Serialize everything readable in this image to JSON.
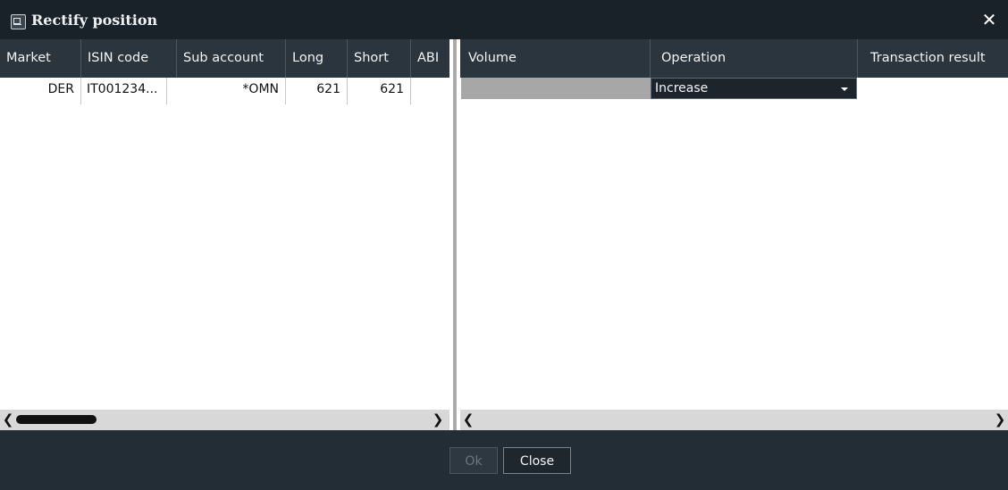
{
  "window": {
    "title": "Rectify position",
    "title_icon": "window-icon",
    "close_icon": "close-icon"
  },
  "left_table": {
    "columns": [
      "Market",
      "ISIN code",
      "Sub account",
      "Long",
      "Short",
      "ABI"
    ],
    "rows": [
      {
        "market": "DER",
        "isin": "IT001234...",
        "sub_account": "*OMN",
        "long": "621",
        "short": "621",
        "abi": ""
      }
    ]
  },
  "right_table": {
    "columns": [
      "Volume",
      "Operation",
      "Transaction result"
    ],
    "rows": [
      {
        "volume": "",
        "operation": "Increase",
        "result": ""
      }
    ]
  },
  "scrollbars": {
    "left_arrow": "chevron-left-icon",
    "right_arrow": "chevron-right-icon"
  },
  "buttons": {
    "ok": "Ok",
    "close": "Close"
  }
}
